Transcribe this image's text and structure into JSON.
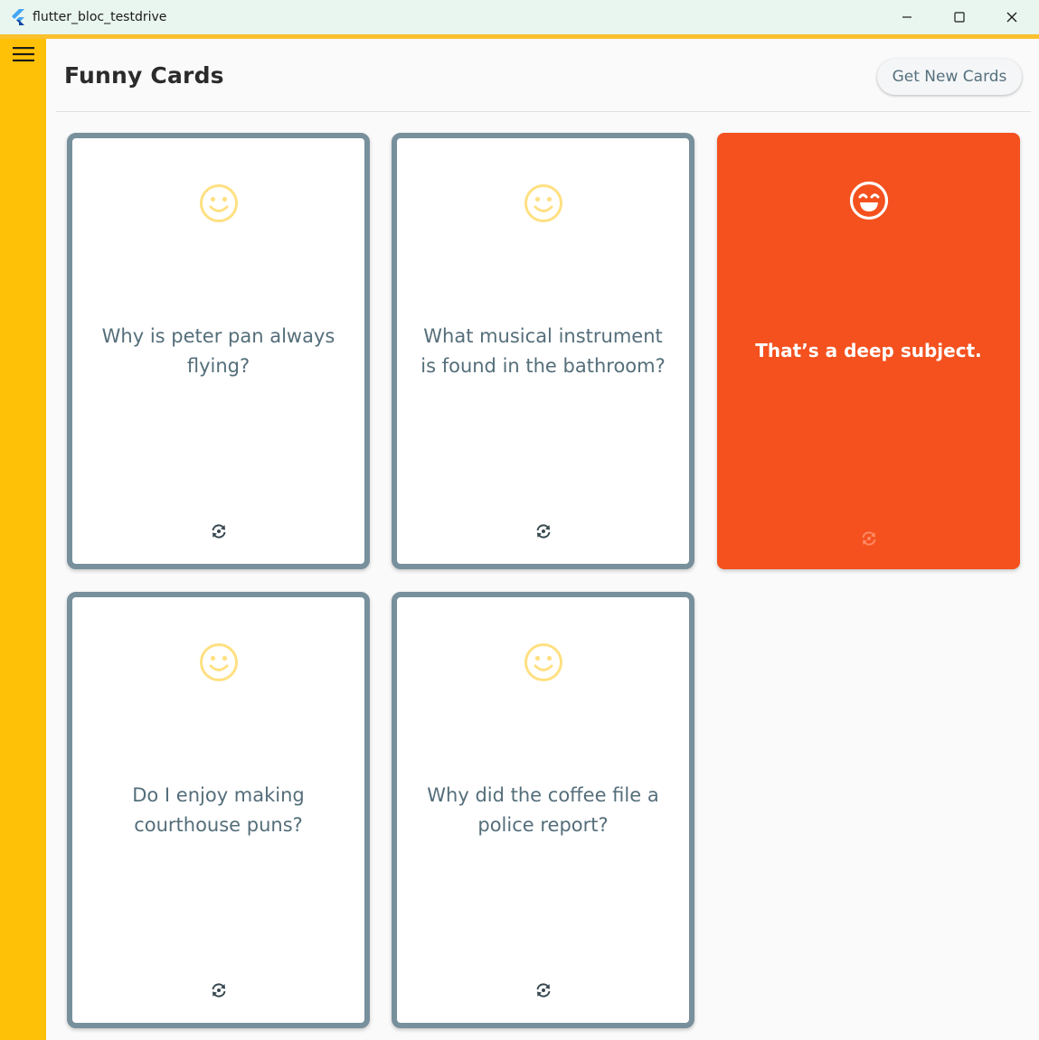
{
  "window": {
    "title": "flutter_bloc_testdrive",
    "icons": [
      "flutter-logo-icon",
      "minimize-icon",
      "maximize-icon",
      "close-icon"
    ]
  },
  "toolbar": {
    "menu_icon": "hamburger-menu-icon",
    "title": "Funny Cards",
    "new_cards_label": "Get New Cards"
  },
  "colors": {
    "rail": "#ffc107",
    "accent_strip": "#fbc02d",
    "card_border": "#78909c",
    "card_text": "#546e7a",
    "flipped_card": "#f4511e",
    "smiley": "#ffe082"
  },
  "cards": [
    {
      "text": "Why is peter pan always flying?",
      "face_icon": "smiley-face-icon",
      "flip_icon": "flip-card-icon",
      "flipped": false
    },
    {
      "text": "What musical instrument is found in the bathroom?",
      "face_icon": "smiley-face-icon",
      "flip_icon": "flip-card-icon",
      "flipped": false
    },
    {
      "text": "That’s a deep subject.",
      "face_icon": "laughing-face-icon",
      "flip_icon": "flip-card-icon",
      "flipped": true
    },
    {
      "text": "Do I enjoy making courthouse puns?",
      "face_icon": "smiley-face-icon",
      "flip_icon": "flip-card-icon",
      "flipped": false
    },
    {
      "text": "Why did the coffee file a police report?",
      "face_icon": "smiley-face-icon",
      "flip_icon": "flip-card-icon",
      "flipped": false
    }
  ]
}
